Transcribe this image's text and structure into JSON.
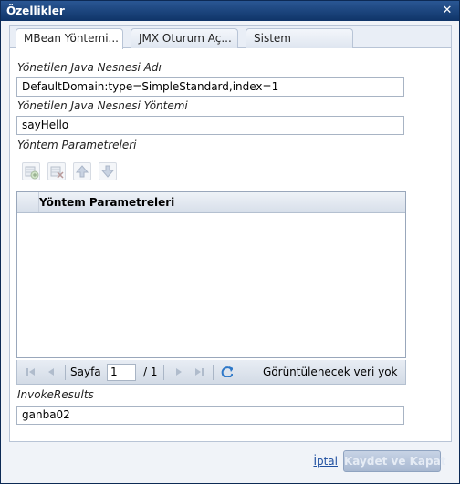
{
  "window": {
    "title": "Özellikler"
  },
  "tabs": [
    {
      "label": "MBean Yöntemi..."
    },
    {
      "label": "JMX Oturum Aç..."
    },
    {
      "label": "Sistem"
    }
  ],
  "form": {
    "object_name_label": "Yönetilen Java Nesnesi Adı",
    "object_name_value": "DefaultDomain:type=SimpleStandard,index=1",
    "method_label": "Yönetilen Java Nesnesi Yöntemi",
    "method_value": "sayHello",
    "params_label": "Yöntem Parametreleri",
    "results_label": "InvokeResults",
    "results_value": "ganba02"
  },
  "grid": {
    "column_header": "Yöntem Parametreleri"
  },
  "pager": {
    "page_label": "Sayfa",
    "page_value": "1",
    "page_total": "/ 1",
    "status": "Görüntülenecek veri yok"
  },
  "footer": {
    "cancel_label": "İptal",
    "save_label": "Kaydet ve Kapat"
  },
  "icons": {
    "close": "close-icon",
    "add_row": "add-row-icon",
    "delete_row": "delete-row-icon",
    "move_up": "arrow-up-icon",
    "move_down": "arrow-down-icon",
    "first": "first-page-icon",
    "prev": "prev-page-icon",
    "next": "next-page-icon",
    "last": "last-page-icon",
    "refresh": "refresh-icon"
  },
  "colors": {
    "titlebar": "#1a437c",
    "accent": "#1f4fa0"
  }
}
